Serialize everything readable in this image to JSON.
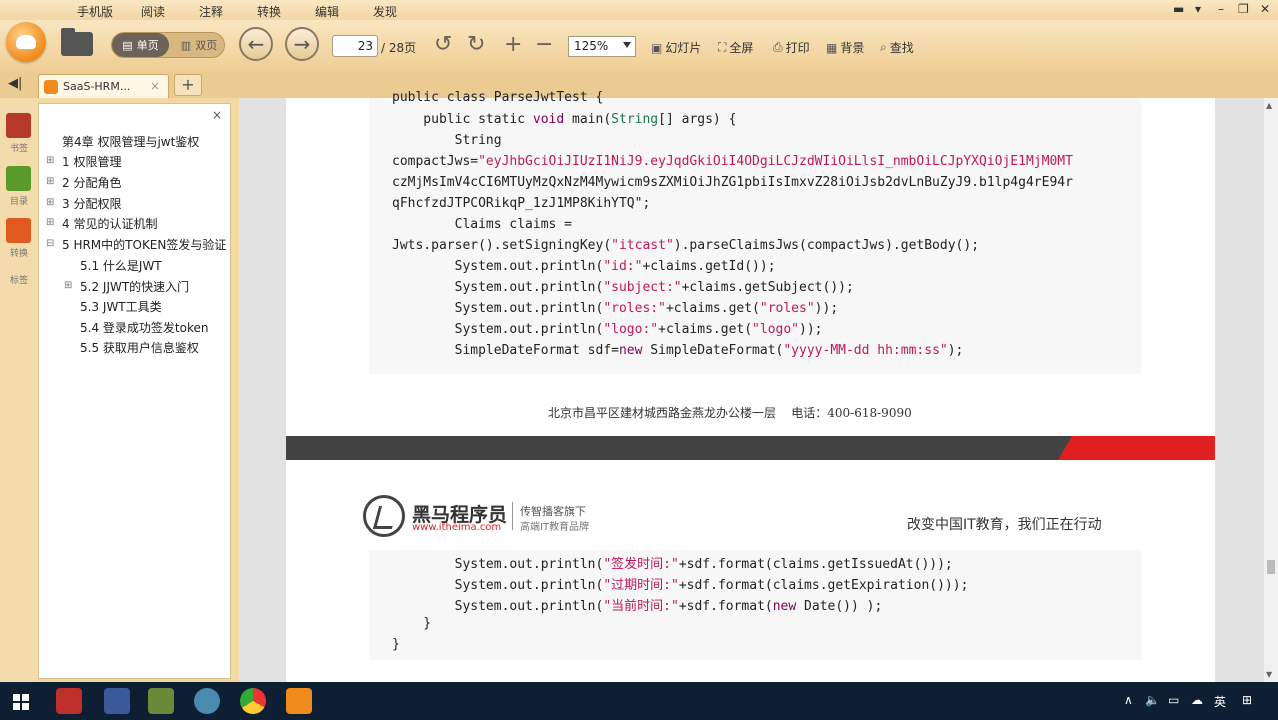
{
  "menu": {
    "items": [
      "手机版",
      "阅读",
      "注释",
      "转换",
      "编辑",
      "发现"
    ]
  },
  "toolbar": {
    "single_page": "单页",
    "double_page": "双页",
    "page_current": "23",
    "page_total": "/ 28页",
    "zoom": "125%",
    "slideshow": "幻灯片",
    "fullscreen": "全屏",
    "print": "打印",
    "background": "背景",
    "find": "查找"
  },
  "tab": {
    "title": "SaaS-HRM...",
    "add": "+"
  },
  "left_strip": {
    "labels": [
      "书签",
      "目录",
      "转换",
      "标签"
    ]
  },
  "outline": {
    "close": "×",
    "items": [
      "第4章 权限管理与jwt鉴权",
      "1 权限管理",
      "2 分配角色",
      "3 分配权限",
      "4 常见的认证机制",
      "5 HRM中的TOKEN签发与验证",
      "5.1 什么是JWT",
      "5.2 JJWT的快速入门",
      "5.3 JWT工具类",
      "5.4 登录成功签发token",
      "5.5 获取用户信息鉴权"
    ]
  },
  "page1": {
    "code": {
      "l0": "public class ParseJwtTest {",
      "l1_pre": "    public static ",
      "l1_void": "void",
      "l1_mid": " main(",
      "l1_type": "String",
      "l1_post": "[] args) {",
      "l2": "        String",
      "l3_pre": "compactJws=",
      "l3_str": "\"eyJhbGciOiJIUzI1NiJ9.eyJqdGkiOiI4ODgiLCJzdWIiOiLlsI_nmbOiLCJpYXQiOjE1MjM0MT",
      "l4_str": "czMjMsImV4cCI6MTUyMzQxNzM4Mywicm9sZXMiOiJhZG1pbiIsImxvZ28iOiJsb2dvLnBuZyJ9.b1lp4g4rE94r",
      "l5_str": "qFhcfzdJTPCORikqP_1zJ1MP8KihYTQ\";",
      "l6": "        Claims claims =",
      "l7_pre": "Jwts.parser().setSigningKey(",
      "l7_str": "\"itcast\"",
      "l7_post": ").parseClaimsJws(compactJws).getBody();",
      "l8_pre": "        System.out.println(",
      "l8_str": "\"id:\"",
      "l8_post": "+claims.getId());",
      "l9_pre": "        System.out.println(",
      "l9_str": "\"subject:\"",
      "l9_post": "+claims.getSubject());",
      "l10_pre": "        System.out.println(",
      "l10_str": "\"roles:\"",
      "l10_post": "+claims.get(",
      "l10_str2": "\"roles\"",
      "l10_post2": "));",
      "l11_pre": "        System.out.println(",
      "l11_str": "\"logo:\"",
      "l11_post": "+claims.get(",
      "l11_str2": "\"logo\"",
      "l11_post2": "));",
      "l12_pre": "        SimpleDateFormat sdf=",
      "l12_new": "new",
      "l12_mid": " SimpleDateFormat(",
      "l12_str": "\"yyyy-MM-dd hh:mm:ss\"",
      "l12_post": ");"
    },
    "footer": "北京市昌平区建材城西路金燕龙办公楼一层    电话：400-618-9090"
  },
  "page2": {
    "brand": "黑马程序员",
    "url": "www.itheima.com",
    "slogan_top": "传智播客旗下",
    "slogan_bottom": "高端IT教育品牌",
    "slogan_right": "改变中国IT教育，我们正在行动",
    "code": {
      "l0_pre": "        System.out.println(",
      "l0_str": "\"签发时间:\"",
      "l0_post": "+sdf.format(claims.getIssuedAt()));",
      "l1_pre": "        System.out.println(",
      "l1_str": "\"过期时间:\"",
      "l1_post": "+sdf.format(claims.getExpiration()));",
      "l2_pre": "        System.out.println(",
      "l2_str": "\"当前时间:\"",
      "l2_post": "+sdf.format(",
      "l2_new": "new",
      "l2_post2": " Date()) );",
      "l3": "    }",
      "l4": "}"
    }
  },
  "taskbar": {
    "ime": "英",
    "ime2": "⊞"
  },
  "colors": {
    "chrome": "#f3d8a4",
    "keyword": "#7f0055",
    "string": "#c2185b",
    "type": "#1a7a4a",
    "brand_red": "#e02020"
  }
}
